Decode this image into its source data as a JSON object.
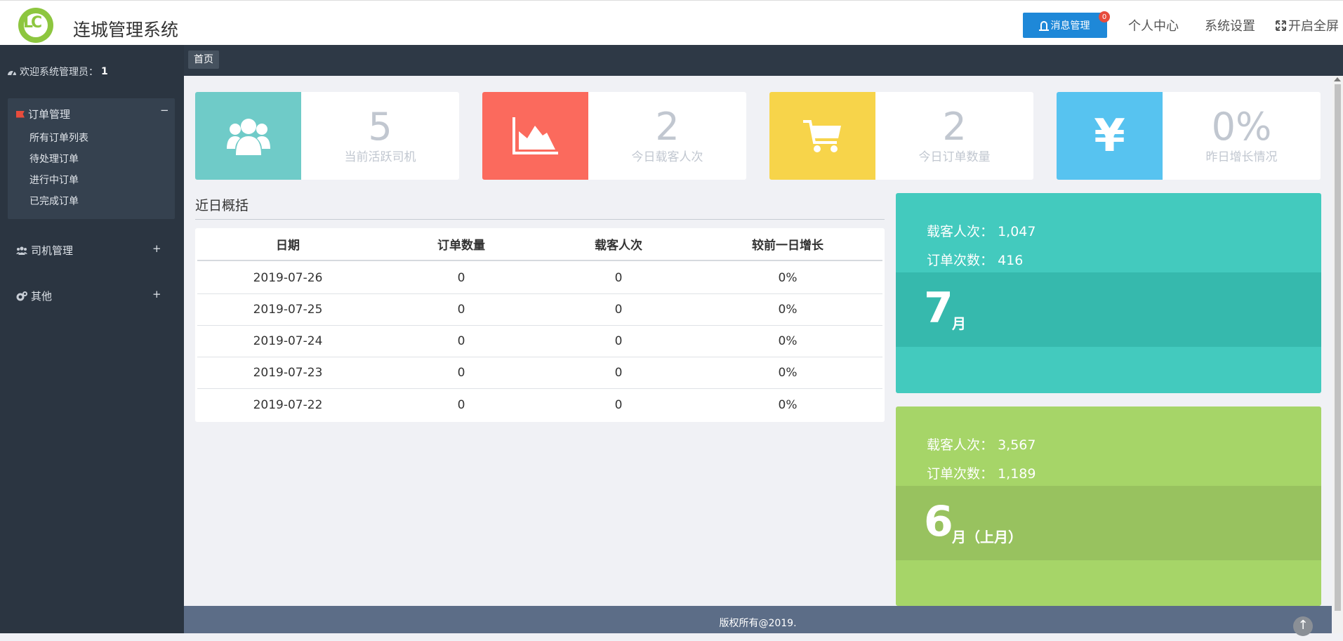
{
  "header": {
    "logo_text": "LC",
    "title": "连城管理系统",
    "message_button": "消息管理",
    "message_badge": "0",
    "personal_center": "个人中心",
    "system_settings": "系统设置",
    "fullscreen": "开启全屏"
  },
  "sidebar": {
    "welcome_label": "欢迎系统管理员：",
    "welcome_value": "1",
    "groups": [
      {
        "label": "订单管理",
        "sign": "−",
        "items": [
          "所有订单列表",
          "待处理订单",
          "进行中订单",
          "已完成订单"
        ]
      },
      {
        "label": "司机管理",
        "sign": "+"
      },
      {
        "label": "其他",
        "sign": "+"
      }
    ]
  },
  "breadcrumb": {
    "home": "首页"
  },
  "stats": [
    {
      "value": "5",
      "label": "当前活跃司机",
      "icon": "users-icon",
      "color": "#6fcbc8"
    },
    {
      "value": "2",
      "label": "今日载客人次",
      "icon": "area-chart-icon",
      "color": "#fb6a5d"
    },
    {
      "value": "2",
      "label": "今日订单数量",
      "icon": "cart-icon",
      "color": "#f7d44a"
    },
    {
      "value": "0%",
      "label": "昨日增长情况",
      "icon": "yen-icon",
      "color": "#57c3f0",
      "glyph": "¥"
    }
  ],
  "overview": {
    "title": "近日概括",
    "headers": [
      "日期",
      "订单数量",
      "载客人次",
      "较前一日增长"
    ],
    "rows": [
      [
        "2019-07-26",
        "0",
        "0",
        "0%"
      ],
      [
        "2019-07-25",
        "0",
        "0",
        "0%"
      ],
      [
        "2019-07-24",
        "0",
        "0",
        "0%"
      ],
      [
        "2019-07-23",
        "0",
        "0",
        "0%"
      ],
      [
        "2019-07-22",
        "0",
        "0",
        "0%"
      ]
    ]
  },
  "months": [
    {
      "passengers_label": "载客人次：",
      "passengers": "1,047",
      "orders_label": "订单次数：",
      "orders": "416",
      "month": "7",
      "suffix": "月",
      "color": "#43cabe",
      "band_color": "#36b9ad"
    },
    {
      "passengers_label": "载客人次：",
      "passengers": "3,567",
      "orders_label": "订单次数：",
      "orders": "1,189",
      "month": "6",
      "suffix": "月（上月）",
      "color": "#a6d568",
      "band_color": "#98c25f"
    }
  ],
  "footer": {
    "copyright": "版权所有@2019.",
    "to_top": "↑"
  }
}
